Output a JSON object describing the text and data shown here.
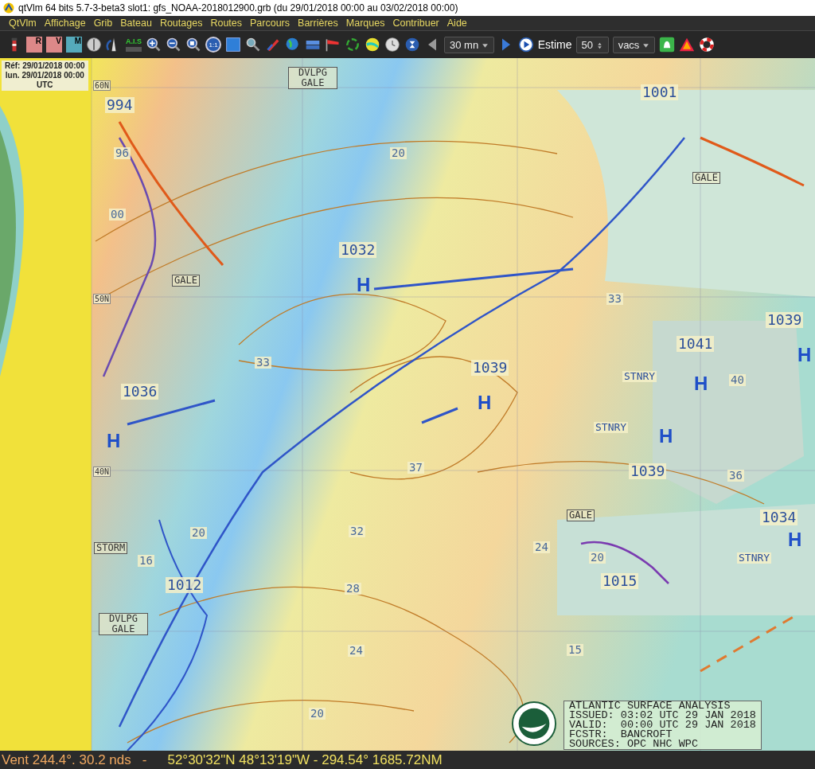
{
  "window": {
    "title": "qtVlm 64 bits 5.7-3-beta3 slot1: gfs_NOAA-2018012900.grb (du 29/01/2018 00:00 au 03/02/2018 00:00)"
  },
  "menu": [
    "QtVlm",
    "Affichage",
    "Grib",
    "Bateau",
    "Routages",
    "Routes",
    "Parcours",
    "Barrières",
    "Marques",
    "Contribuer",
    "Aide"
  ],
  "toolbar": {
    "tiles": [
      "R",
      "V",
      "M"
    ],
    "ais": "A.I.S",
    "zoom_one": "1:1",
    "step": "30 mn",
    "estimate_label": "Estime",
    "estimate_value": "50",
    "unit": "vacs"
  },
  "info_box": [
    "Réf: 29/01/2018 00:00",
    "lun. 29/01/2018 00:00",
    "UTC"
  ],
  "map_labels": [
    {
      "text": "994",
      "kind": "pressure"
    },
    {
      "text": "1001",
      "kind": "pressure"
    },
    {
      "text": "1032",
      "kind": "pressure"
    },
    {
      "text": "1039",
      "kind": "pressure"
    },
    {
      "text": "1041",
      "kind": "pressure"
    },
    {
      "text": "1039",
      "kind": "pressure"
    },
    {
      "text": "1036",
      "kind": "pressure"
    },
    {
      "text": "1039",
      "kind": "pressure"
    },
    {
      "text": "1034",
      "kind": "pressure"
    },
    {
      "text": "1012",
      "kind": "pressure"
    },
    {
      "text": "1015",
      "kind": "pressure"
    },
    {
      "text": "H",
      "kind": "high"
    },
    {
      "text": "H",
      "kind": "high"
    },
    {
      "text": "H",
      "kind": "high"
    },
    {
      "text": "H",
      "kind": "high"
    },
    {
      "text": "H",
      "kind": "high"
    },
    {
      "text": "H",
      "kind": "high"
    },
    {
      "text": "H",
      "kind": "high"
    },
    {
      "text": "DVLPG GALE",
      "kind": "warning"
    },
    {
      "text": "GALE",
      "kind": "warning"
    },
    {
      "text": "GALE",
      "kind": "warning"
    },
    {
      "text": "GALE",
      "kind": "warning"
    },
    {
      "text": "STORM",
      "kind": "warning"
    },
    {
      "text": "DVLPG GALE",
      "kind": "warning"
    },
    {
      "text": "STNRY",
      "kind": "front"
    },
    {
      "text": "STNRY",
      "kind": "front"
    },
    {
      "text": "STNRY",
      "kind": "front"
    },
    {
      "text": "20",
      "kind": "isobar"
    },
    {
      "text": "33",
      "kind": "isobar"
    },
    {
      "text": "33",
      "kind": "isobar"
    },
    {
      "text": "37",
      "kind": "isobar"
    },
    {
      "text": "40",
      "kind": "isobar"
    },
    {
      "text": "36",
      "kind": "isobar"
    },
    {
      "text": "32",
      "kind": "isobar"
    },
    {
      "text": "28",
      "kind": "isobar"
    },
    {
      "text": "24",
      "kind": "isobar"
    },
    {
      "text": "20",
      "kind": "isobar"
    },
    {
      "text": "16",
      "kind": "isobar"
    },
    {
      "text": "15",
      "kind": "isobar"
    },
    {
      "text": "20",
      "kind": "isobar"
    },
    {
      "text": "20",
      "kind": "isobar"
    },
    {
      "text": "24",
      "kind": "isobar"
    },
    {
      "text": "96",
      "kind": "isobar"
    },
    {
      "text": "00",
      "kind": "isobar"
    },
    {
      "text": "60N",
      "kind": "latitude"
    },
    {
      "text": "50N",
      "kind": "latitude"
    },
    {
      "text": "40N",
      "kind": "latitude"
    }
  ],
  "legend": [
    "ATLANTIC SURFACE ANALYSIS",
    "ISSUED: 03:02 UTC 29 JAN 2018",
    "VALID:  00:00 UTC 29 JAN 2018",
    "FCSTR:  BANCROFT",
    "SOURCES: OPC NHC WPC"
  ],
  "status_bar": {
    "wind": "Vent 244.4°. 30.2 nds",
    "separator": "-",
    "position": "52°30'32\"N  48°13'19\"W - 294.54° 1685.72NM"
  }
}
